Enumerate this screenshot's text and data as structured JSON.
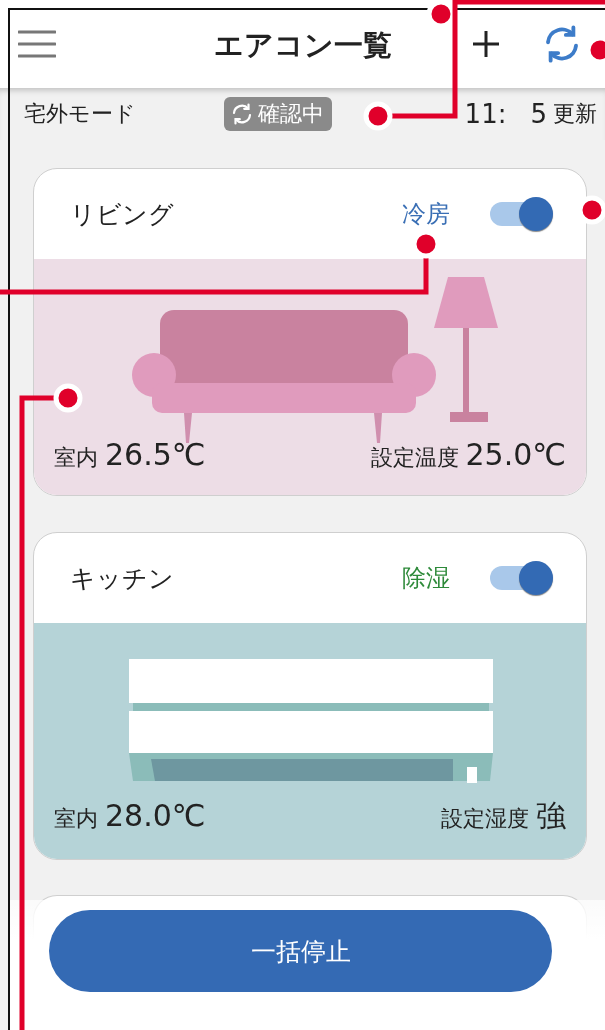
{
  "header": {
    "title": "エアコン一覧"
  },
  "status_bar": {
    "mode": "宅外モード",
    "badge": "確認中",
    "time_parts": [
      "11:",
      "5"
    ],
    "updated": "更新"
  },
  "cards": [
    {
      "name": "リビング",
      "mode": "冷房",
      "color": "#3a6fb5",
      "on": true,
      "kind": "living",
      "indoor_label": "室内",
      "indoor_value": "26.5℃",
      "setting_label": "設定温度",
      "setting_value": "25.0℃"
    },
    {
      "name": "キッチン",
      "mode": "除湿",
      "color": "#2e8a3a",
      "on": true,
      "kind": "unit",
      "indoor_label": "室内",
      "indoor_value": "28.0℃",
      "setting_label": "設定湿度",
      "setting_value": "強"
    }
  ],
  "stop_button": "一括停止"
}
